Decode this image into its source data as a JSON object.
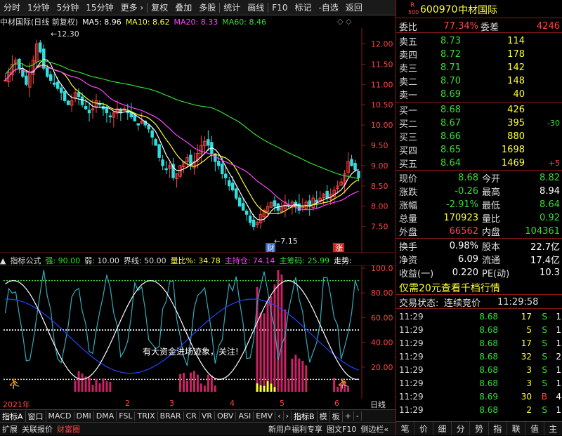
{
  "toolbar": {
    "items": [
      "分时",
      "1分钟",
      "5分钟",
      "15分钟",
      "更多 ›",
      "复权",
      "叠加",
      "多股",
      "统计",
      "画线",
      "F10",
      "标记",
      "-自选",
      "返回"
    ]
  },
  "chart": {
    "stock_label": "中材国际(日线 前复权)",
    "ma5": "MA5: 8.96",
    "ma10": "MA10: 8.62",
    "ma20": "MA20: 8.33",
    "ma60": "MA60: 8.46",
    "high_label": "12.30",
    "low_label": "7.15",
    "price_ticks": [
      "12.00",
      "11.50",
      "11.00",
      "10.50",
      "10.00",
      "9.50",
      "9.00",
      "8.50",
      "8.00",
      "7.50"
    ],
    "marker_cai": "财",
    "marker_zhang": "涨"
  },
  "indicator": {
    "name": "指标公式",
    "strong": "强: 90.00",
    "weak": "弱: 10.00",
    "boundary": "界线: 50.00",
    "volratio": "量比%: 34.78",
    "main_hold": "主持仓: 74.14",
    "main_chip": "主筹码: 25.99",
    "trend": "走势:",
    "ticks": [
      "100.0",
      "80.00",
      "60.00",
      "40.00",
      "20.00"
    ],
    "annotation": "有大资金进场迹象，关注!"
  },
  "xaxis": {
    "year": "2021年",
    "months": [
      "2",
      "3",
      "4",
      "5",
      "6"
    ],
    "right_label": "日线"
  },
  "bottom_tabs": [
    "指标A",
    "窗口",
    "MACD",
    "DMI",
    "DMA",
    "FSL",
    "TRIX",
    "BRAR",
    "CR",
    "VR",
    "OBV",
    "ASI",
    "EMV",
    "‹",
    "›",
    "指标B",
    "模",
    "板",
    "+",
    "-"
  ],
  "status_items": [
    "扩展",
    "关联报价",
    "财富圈",
    "新用户福利专享",
    "图文F10",
    "侧边栏«"
  ],
  "quote": {
    "code": "600970",
    "name": "中材国际",
    "r_badge": "R",
    "r_sub": "500",
    "weibi_label": "委比",
    "weibi": "77.34%",
    "weicha_label": "委差",
    "weicha": "4246",
    "asks": [
      {
        "label": "卖五",
        "price": "8.73",
        "vol": "114"
      },
      {
        "label": "卖四",
        "price": "8.72",
        "vol": "178"
      },
      {
        "label": "卖三",
        "price": "8.71",
        "vol": "142"
      },
      {
        "label": "卖二",
        "price": "8.70",
        "vol": "148"
      },
      {
        "label": "卖一",
        "price": "8.69",
        "vol": "40"
      }
    ],
    "bids": [
      {
        "label": "买一",
        "price": "8.68",
        "vol": "426",
        "chg": ""
      },
      {
        "label": "买二",
        "price": "8.67",
        "vol": "395",
        "chg": "-30"
      },
      {
        "label": "买三",
        "price": "8.66",
        "vol": "880",
        "chg": ""
      },
      {
        "label": "买四",
        "price": "8.65",
        "vol": "1698",
        "chg": ""
      },
      {
        "label": "买五",
        "price": "8.64",
        "vol": "1469",
        "chg": "+5"
      }
    ],
    "stats": [
      {
        "l1": "现价",
        "v1": "8.68",
        "l2": "今开",
        "v2": "8.82"
      },
      {
        "l1": "涨跌",
        "v1": "-0.26",
        "l2": "最高",
        "v2": "8.94"
      },
      {
        "l1": "涨幅",
        "v1": "-2.91%",
        "l2": "最低",
        "v2": "8.64"
      },
      {
        "l1": "总量",
        "v1": "170923",
        "l2": "量比",
        "v2": "0.92"
      },
      {
        "l1": "外盘",
        "v1": "66562",
        "l2": "内盘",
        "v2": "104361"
      }
    ],
    "stats2": [
      {
        "l1": "换手",
        "v1": "0.98%",
        "l2": "股本",
        "v2": "22.7亿"
      },
      {
        "l1": "净资",
        "v1": "6.09",
        "l2": "流通",
        "v2": "17.4亿"
      },
      {
        "l1": "收益(一)",
        "v1": "0.220",
        "l2": "PE(动)",
        "v2": "10.3"
      }
    ],
    "promo": "仅需20元查看千档行情",
    "trade_state_label": "交易状态:",
    "trade_state": "连续竞价",
    "trade_time": "11:29:58",
    "ticks": [
      {
        "t": "11:29",
        "p": "8.68",
        "v": "17",
        "s": "S",
        "n": "1"
      },
      {
        "t": "11:29",
        "p": "8.68",
        "v": "5",
        "s": "S",
        "n": "1"
      },
      {
        "t": "11:29",
        "p": "8.68",
        "v": "17",
        "s": "S",
        "n": "1"
      },
      {
        "t": "11:29",
        "p": "8.68",
        "v": "32",
        "s": "S",
        "n": "2"
      },
      {
        "t": "11:29",
        "p": "8.68",
        "v": "3",
        "s": "S",
        "n": "1"
      },
      {
        "t": "11:29",
        "p": "8.68",
        "v": "3",
        "s": "S",
        "n": "1"
      },
      {
        "t": "11:29",
        "p": "8.69",
        "v": "30",
        "s": "B",
        "n": "4"
      },
      {
        "t": "11:29",
        "p": "8.68",
        "v": "2",
        "s": "S",
        "n": "1"
      }
    ],
    "tabs": [
      "笔",
      "价",
      "细",
      "分",
      "势",
      "指",
      "联",
      "值",
      "主"
    ]
  },
  "colors": {
    "up": "#ff4444",
    "down": "#33dddd",
    "ma5": "#ffffff",
    "ma10": "#ffff33",
    "ma20": "#ff44ff",
    "ma60": "#33dd33",
    "frame": "#8b1a1a"
  }
}
